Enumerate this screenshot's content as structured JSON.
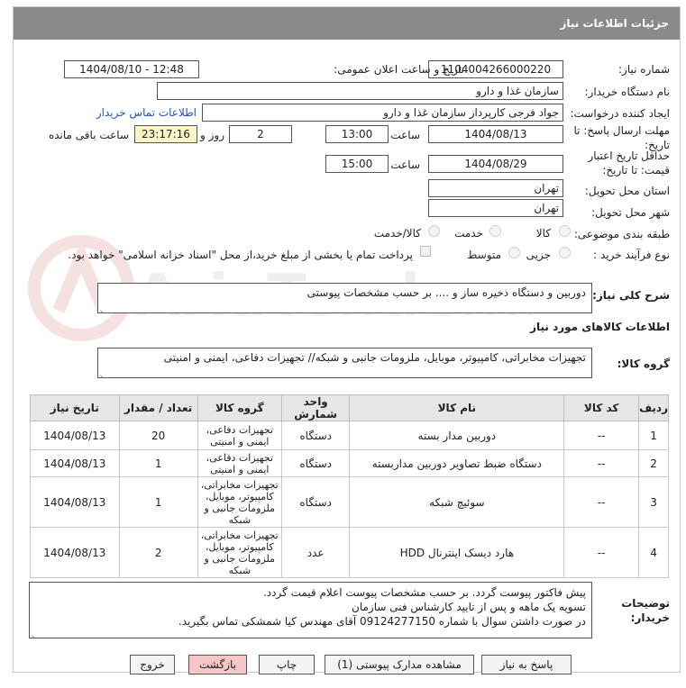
{
  "header": {
    "title": "جزئیات اطلاعات نیاز"
  },
  "form": {
    "need_number_label": "شماره نیاز:",
    "need_number": "1104004266000220",
    "announce_label": "تاریخ و ساعت اعلان عمومی:",
    "announce_value": "1404/08/10 - 12:48",
    "buyer_org_label": "نام دستگاه خریدار:",
    "buyer_org": "سازمان غذا و دارو",
    "requester_label": "ایجاد کننده درخواست:",
    "requester": "جواد فرجی کارپرداز سازمان غذا و دارو",
    "contact_link": "اطلاعات تماس خریدار",
    "deadline_label": "مهلت ارسال پاسخ: تا تاریخ:",
    "deadline_date": "1404/08/13",
    "time_label": "ساعت",
    "deadline_time": "13:00",
    "days_count": "2",
    "days_label": "روز و",
    "remaining_time": "23:17:16",
    "remaining_label": "ساعت باقی مانده",
    "price_validity_label": "حداقل تاریخ اعتبار قیمت: تا تاریخ:",
    "price_validity_date": "1404/08/29",
    "price_validity_time": "15:00",
    "province_label": "استان محل تحویل:",
    "province": "تهران",
    "city_label": "شهر محل تحویل:",
    "city": "تهران",
    "category_label": "طبقه بندی موضوعی:",
    "category_options": [
      "کالا",
      "خدمت",
      "کالا/خدمت"
    ],
    "process_label": "نوع فرآیند خرید :",
    "process_options": [
      "جزیی",
      "متوسط"
    ],
    "payment_note": "پرداخت تمام یا بخشی از مبلغ خرید،از محل \"اسناد خزانه اسلامی\" خواهد بود."
  },
  "summary": {
    "label": "شرح کلی نیاز:",
    "text": "دوربین و دستگاه ذخیره ساز و .... بر حسب مشخصات پیوستی"
  },
  "goods_section": {
    "title": "اطلاعات کالاهای مورد نیاز",
    "group_label": "گروه کالا:",
    "group_text": "تجهیزات مخابراتی، کامپیوتر، موبایل، ملزومات جانبی و شبکه// تجهیزات دفاعی، ایمنی و امنیتی"
  },
  "table": {
    "headers": [
      "ردیف",
      "کد کالا",
      "نام کالا",
      "واحد شمارش",
      "گروه کالا",
      "تعداد / مقدار",
      "تاریخ نیاز"
    ],
    "rows": [
      {
        "row": "1",
        "code": "--",
        "name": "دوربین مدار بسته",
        "unit": "دستگاه",
        "group": "تجهیزات دفاعی، ایمنی و امنیتی",
        "qty": "20",
        "date": "1404/08/13"
      },
      {
        "row": "2",
        "code": "--",
        "name": "دستگاه ضبط تصاویر دوربین مداربسته",
        "unit": "دستگاه",
        "group": "تجهیزات دفاعی، ایمنی و امنیتی",
        "qty": "1",
        "date": "1404/08/13"
      },
      {
        "row": "3",
        "code": "--",
        "name": "سوئیچ شبکه",
        "unit": "دستگاه",
        "group": "تجهیزات مخابراتی، کامپیوتر، موبایل، ملزومات جانبی و شبکه",
        "qty": "1",
        "date": "1404/08/13"
      },
      {
        "row": "4",
        "code": "--",
        "name": "هارد دیسک اینترنال HDD",
        "unit": "عدد",
        "group": "تجهیزات مخابراتی، کامپیوتر، موبایل، ملزومات جانبی و شبکه",
        "qty": "2",
        "date": "1404/08/13"
      }
    ]
  },
  "buyer_notes": {
    "label": "توضیحات خریدار:",
    "lines": [
      "پیش فاکتور پیوست گردد. بر حسب مشخصات پیوست اعلام قیمت گردد.",
      "تسویه یک ماهه و پس از تایید کارشناس فنی سازمان",
      "در صورت داشتن سوال با شماره 09124277150 آقای مهندس کیا شمشکی تماس بگیرید."
    ]
  },
  "buttons": {
    "reply": "پاسخ به نیاز",
    "attachments": "مشاهده مدارک پیوستی (1)",
    "print": "چاپ",
    "back": "بازگشت",
    "exit": "خروج"
  },
  "watermark": {
    "text": "AriaTender.net"
  },
  "colors": {
    "header_bg": "#8a8a8a",
    "link": "#1a56c7",
    "remaining_bg": "#fbf6c6",
    "pink_button": "#f6c7c7"
  }
}
